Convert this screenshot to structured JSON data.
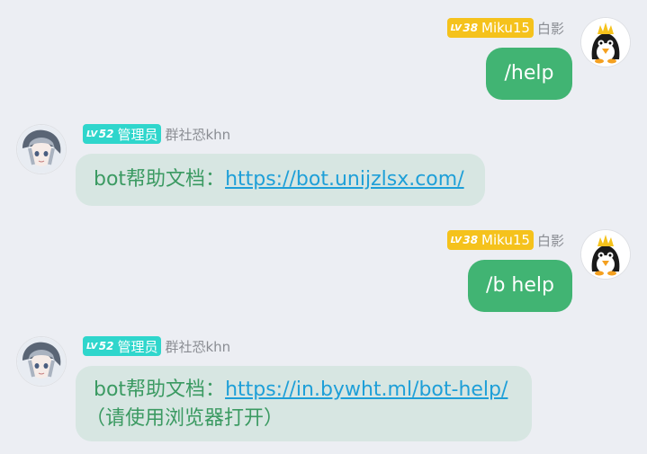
{
  "messages": [
    {
      "side": "right",
      "level": "38",
      "title": "Miku15",
      "nickname": "白影",
      "text": "/help",
      "avatar_icon": "penguin-avatar"
    },
    {
      "side": "left",
      "level": "52",
      "title": "管理员",
      "nickname": "群社恐khn",
      "prefix": "bot帮助文档：",
      "link": "https://bot.unijzlsx.com/",
      "avatar_icon": "anime-girl-avatar"
    },
    {
      "side": "right",
      "level": "38",
      "title": "Miku15",
      "nickname": "白影",
      "text": "/b help",
      "avatar_icon": "penguin-avatar"
    },
    {
      "side": "left",
      "level": "52",
      "title": "管理员",
      "nickname": "群社恐khn",
      "prefix": "bot帮助文档：",
      "link": "https://in.bywht.ml/bot-help/",
      "suffix": "（请使用浏览器打开）",
      "avatar_icon": "anime-girl-avatar"
    }
  ],
  "lv_prefix": "LV",
  "colors": {
    "background": "#eceef3",
    "self_bubble": "#41b473",
    "other_bubble": "#d7e6e2",
    "other_text": "#3b9a62",
    "link": "#1e9fd8",
    "badge_yellow": "#f5c21c",
    "badge_teal": "#2fd6cc",
    "nickname": "#8a8d93"
  }
}
